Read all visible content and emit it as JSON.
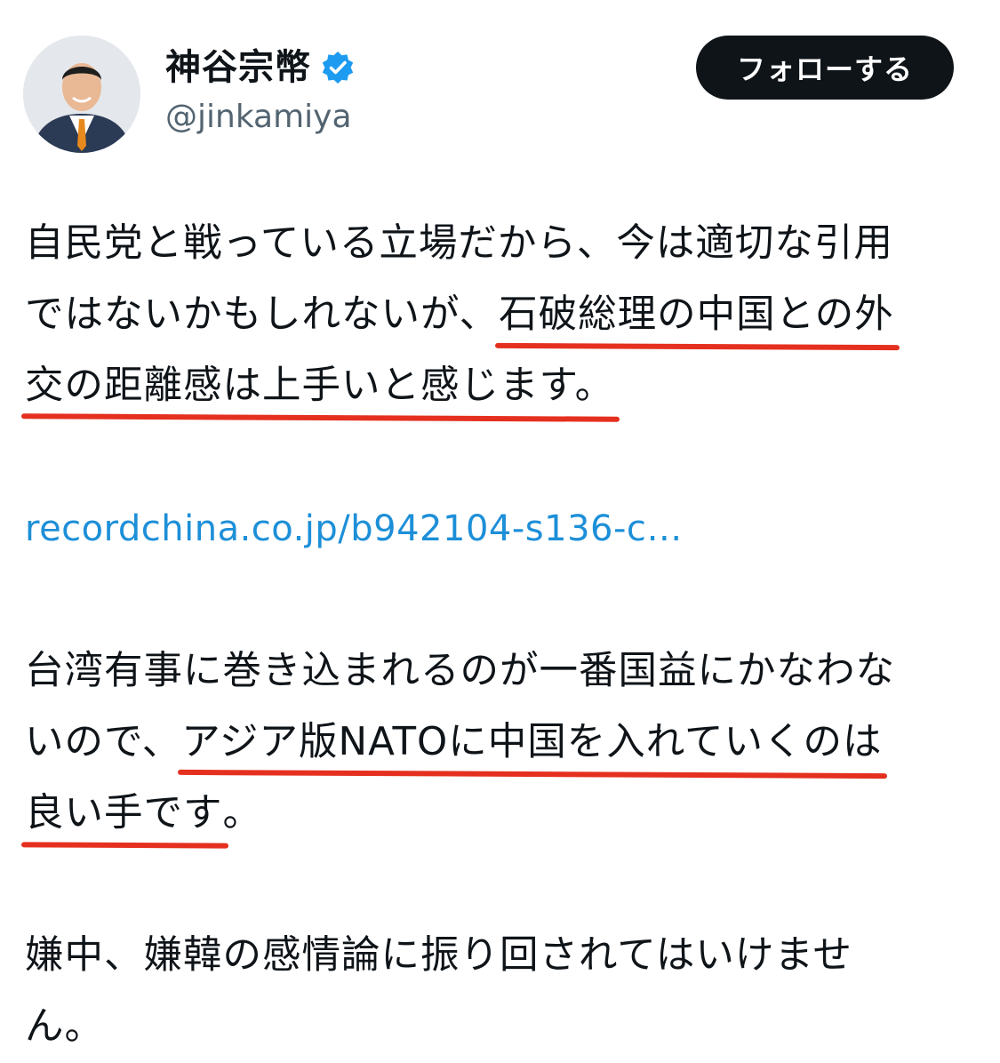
{
  "author": {
    "display_name": "神谷宗幣",
    "handle": "@jinkamiya",
    "verified_icon": "verified-badge-icon",
    "avatar_icon": "profile-photo"
  },
  "follow_button": {
    "label": "フォローする"
  },
  "tweet": {
    "p1_line1": "自民党と戦っている立場だから、今は適切な引用",
    "p1_line2_pre": "ではないかもしれないが、",
    "p1_line2_hl": "石破総理の中国との外",
    "p1_line3_hl": "交の距離感は上手いと感じます。",
    "link_text": "recordchina.co.jp/b942104-s136-c…",
    "p3_line1": "台湾有事に巻き込まれるのが一番国益にかなわな",
    "p3_line2_pre": "いので、",
    "p3_line2_hl": "アジア版NATOに中国を入れていくのは",
    "p3_line3_hl": "良い手です",
    "p3_line3_post": "。",
    "p4_line1": "嫌中、嫌韓の感情論に振り回されてはいけませ",
    "p4_line2": "ん。"
  },
  "colors": {
    "accent_link": "#1d8fd8",
    "underline": "#e5301f",
    "verified": "#1d9bf0",
    "button_bg": "#0f1419"
  }
}
